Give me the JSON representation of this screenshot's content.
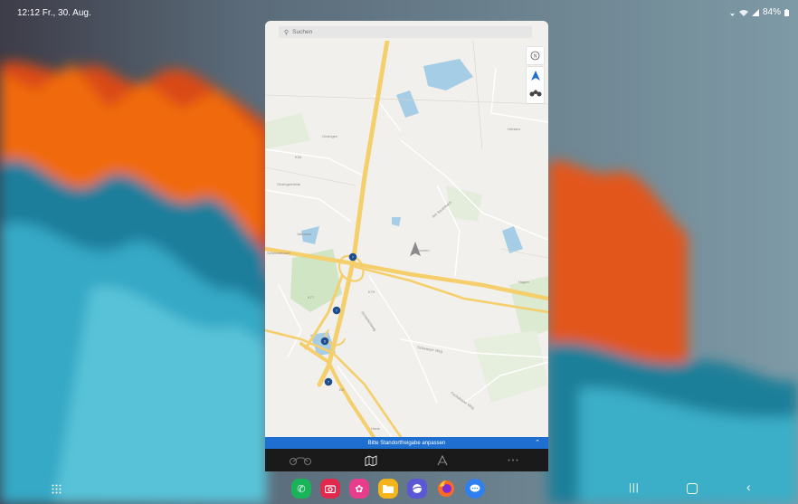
{
  "status_bar": {
    "time_date": "12:12  Fr., 30. Aug.",
    "battery_text": "84%",
    "icons": [
      "location-icon",
      "wifi-icon",
      "signal-icon",
      "battery-icon"
    ]
  },
  "app": {
    "search_placeholder": "Suchen",
    "map": {
      "place_labels": [
        "Gözingen",
        "Gözingerheide",
        "Jahnsten",
        "Schweiderdorf",
        "Hörsten",
        "Hagen",
        "Suchen",
        "Horst"
      ],
      "road_labels": [
        "K34",
        "K77",
        "K79",
        "K9",
        "Am Sauerbach",
        "Schierlichtweg",
        "Schwarzer Weg",
        "Fuchsbauer Weg",
        "K8"
      ],
      "motorway_markers": [
        "7",
        "7",
        "5",
        "7"
      ]
    },
    "map_controls": [
      "compass-icon",
      "navigation-arrow-icon",
      "motorcycle-icon"
    ],
    "banner_text": "Bitte Standortfreigabe anpassen",
    "tabs": [
      "motorcycle-tab",
      "map-tab",
      "route-tab",
      "more-tab"
    ]
  },
  "dock": {
    "apps": [
      {
        "name": "phone",
        "color": "#19b35a"
      },
      {
        "name": "camera",
        "color": "#e3284d"
      },
      {
        "name": "bixby-flower",
        "color": "#e83d8c"
      },
      {
        "name": "files",
        "color": "#f5b51a"
      },
      {
        "name": "internet",
        "color": "#5b58d6"
      },
      {
        "name": "firefox",
        "color": "#ff6a1e"
      },
      {
        "name": "messages",
        "color": "#2f7ff0"
      }
    ]
  }
}
